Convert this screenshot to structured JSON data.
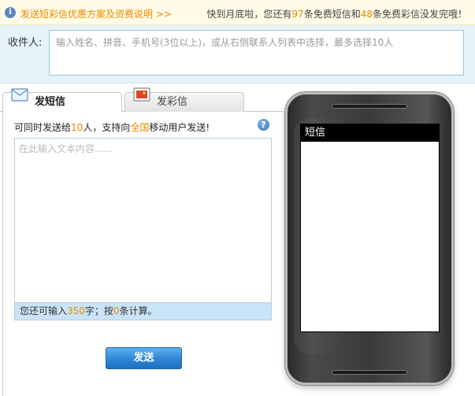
{
  "notice": {
    "left_link": "发送短彩信优惠方案及资费说明 >>",
    "right_prefix": "快到月底啦，您还有",
    "sms_count": "97",
    "mid_text": "条免费短信和",
    "mms_count": "48",
    "right_suffix": "条免费彩信没发完哦！"
  },
  "recipient": {
    "label": "收件人:",
    "placeholder": "输入姓名、拼音、手机号(3位以上)，或从右侧联系人列表中选择，最多选择10人"
  },
  "tabs": [
    {
      "label": "发短信",
      "icon": "envelope-icon",
      "active": true
    },
    {
      "label": "发彩信",
      "icon": "mms-icon",
      "active": false
    }
  ],
  "compose": {
    "hint_prefix": "可同时发送给",
    "hint_count": "10",
    "hint_mid": "人，支持向",
    "hint_highlight": "全国",
    "hint_suffix": "移动用户发送!",
    "placeholder": "在此输入文本内容......",
    "counter_prefix": "您还可输入",
    "counter_chars": "350",
    "counter_mid": "字；按",
    "counter_msgs": "0",
    "counter_suffix": "条计算。",
    "send_label": "发送"
  },
  "phone": {
    "screen_title": "短信"
  },
  "colors": {
    "accent_orange": "#ee8a00",
    "recipient_bg": "#e6f3fb",
    "send_button": "#2f86d6"
  }
}
